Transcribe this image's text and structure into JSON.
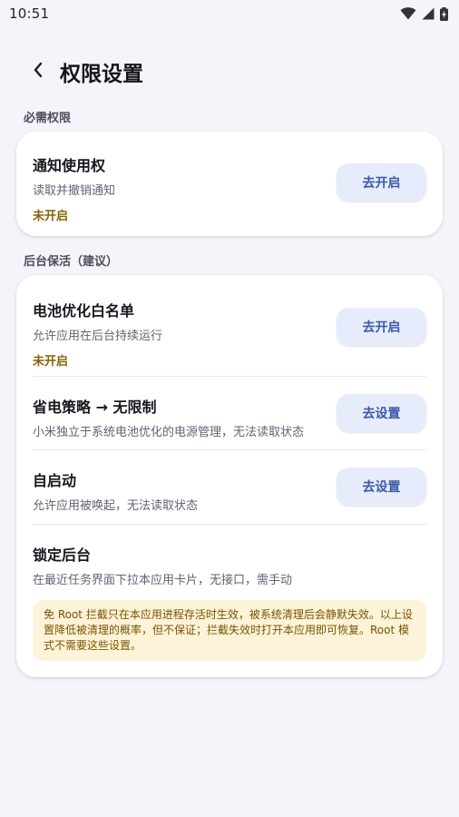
{
  "status_bar": {
    "time": "10:51",
    "icons": [
      "wifi-icon",
      "cell-signal-icon",
      "battery-charging-icon"
    ]
  },
  "app_bar": {
    "back_icon": "chevron-left-icon",
    "title": "权限设置"
  },
  "sections": {
    "required": {
      "header": "必需权限",
      "items": [
        {
          "title": "通知使用权",
          "desc": "读取并撤销通知",
          "status": "未开启",
          "button": "去开启"
        }
      ]
    },
    "background": {
      "header": "后台保活（建议）",
      "items": [
        {
          "title": "电池优化白名单",
          "desc": "允许应用在后台持续运行",
          "status": "未开启",
          "button": "去开启"
        },
        {
          "title": "省电策略 → 无限制",
          "desc": "小米独立于系统电池优化的电源管理，无法读取状态",
          "button": "去设置"
        },
        {
          "title": "自启动",
          "desc": "允许应用被唤起，无法读取状态",
          "button": "去设置"
        },
        {
          "title": "锁定后台",
          "desc": "在最近任务界面下拉本应用卡片，无接口，需手动"
        }
      ],
      "note": "免 Root 拦截只在本应用进程存活时生效，被系统清理后会静默失效。以上设置降低被清理的概率，但不保证；拦截失效时打开本应用即可恢复。Root 模式不需要这些设置。"
    }
  },
  "colors": {
    "background": "#f4f5fa",
    "card": "#ffffff",
    "button_bg": "#e6ecfb",
    "button_text": "#3a5aa8",
    "status_warning": "#8a6200",
    "note_bg": "#fdf3d8",
    "note_text": "#7a5400"
  }
}
